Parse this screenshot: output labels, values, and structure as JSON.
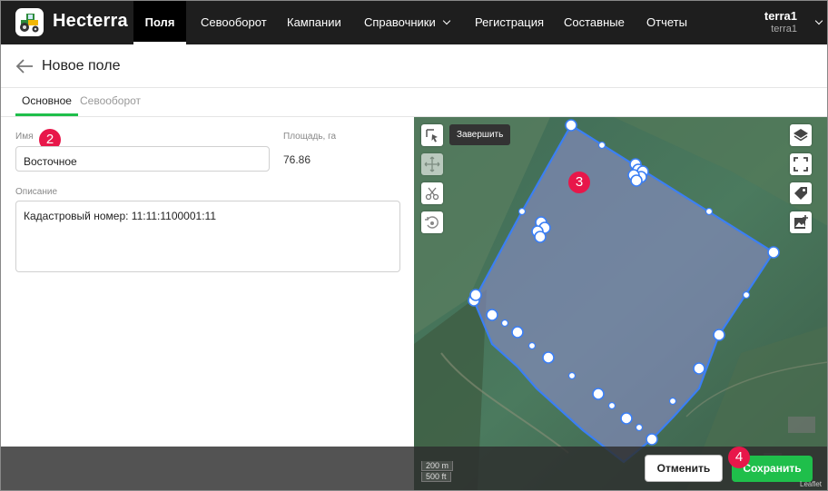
{
  "app": {
    "brand": "Hecterra"
  },
  "nav": {
    "items": [
      {
        "label": "Поля"
      },
      {
        "label": "Севооборот"
      },
      {
        "label": "Кампании"
      },
      {
        "label": "Справочники"
      },
      {
        "label": "Регистрация"
      },
      {
        "label": "Составные"
      },
      {
        "label": "Отчеты"
      }
    ],
    "active_index": 0
  },
  "user": {
    "name": "terra1",
    "login": "terra1"
  },
  "page": {
    "title": "Новое поле"
  },
  "tabs": [
    {
      "label": "Основное",
      "active": true
    },
    {
      "label": "Севооборот",
      "active": false
    }
  ],
  "form": {
    "name_label": "Имя",
    "name_value": "Восточное",
    "area_label": "Площадь, га",
    "area_value": "76.86",
    "description_label": "Описание",
    "description_value": "Кадастровый номер: 11:11:1100001:11"
  },
  "map": {
    "tooltip": "Завершить",
    "scale_metric": "200 m",
    "scale_imperial": "500 ft",
    "attribution": "Leaflet"
  },
  "actions": {
    "cancel": "Отменить",
    "save": "Сохранить"
  },
  "markers": [
    "2",
    "3",
    "4"
  ],
  "colors": {
    "accent": "#1fbf4b",
    "marker": "#e8174a",
    "topbar": "#1e1e1e",
    "polygon": "#3b7ff5"
  }
}
